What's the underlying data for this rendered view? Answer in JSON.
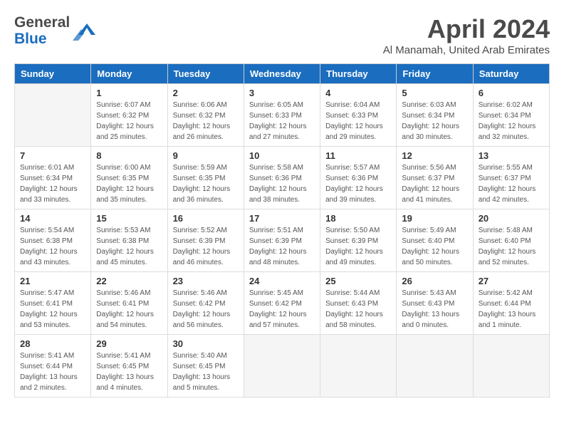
{
  "header": {
    "logo_line1": "General",
    "logo_line2": "Blue",
    "month_title": "April 2024",
    "subtitle": "Al Manamah, United Arab Emirates"
  },
  "days_of_week": [
    "Sunday",
    "Monday",
    "Tuesday",
    "Wednesday",
    "Thursday",
    "Friday",
    "Saturday"
  ],
  "weeks": [
    [
      null,
      {
        "day": "1",
        "sunrise": "6:07 AM",
        "sunset": "6:32 PM",
        "daylight": "12 hours and 25 minutes."
      },
      {
        "day": "2",
        "sunrise": "6:06 AM",
        "sunset": "6:32 PM",
        "daylight": "12 hours and 26 minutes."
      },
      {
        "day": "3",
        "sunrise": "6:05 AM",
        "sunset": "6:33 PM",
        "daylight": "12 hours and 27 minutes."
      },
      {
        "day": "4",
        "sunrise": "6:04 AM",
        "sunset": "6:33 PM",
        "daylight": "12 hours and 29 minutes."
      },
      {
        "day": "5",
        "sunrise": "6:03 AM",
        "sunset": "6:34 PM",
        "daylight": "12 hours and 30 minutes."
      },
      {
        "day": "6",
        "sunrise": "6:02 AM",
        "sunset": "6:34 PM",
        "daylight": "12 hours and 32 minutes."
      }
    ],
    [
      {
        "day": "7",
        "sunrise": "6:01 AM",
        "sunset": "6:34 PM",
        "daylight": "12 hours and 33 minutes."
      },
      {
        "day": "8",
        "sunrise": "6:00 AM",
        "sunset": "6:35 PM",
        "daylight": "12 hours and 35 minutes."
      },
      {
        "day": "9",
        "sunrise": "5:59 AM",
        "sunset": "6:35 PM",
        "daylight": "12 hours and 36 minutes."
      },
      {
        "day": "10",
        "sunrise": "5:58 AM",
        "sunset": "6:36 PM",
        "daylight": "12 hours and 38 minutes."
      },
      {
        "day": "11",
        "sunrise": "5:57 AM",
        "sunset": "6:36 PM",
        "daylight": "12 hours and 39 minutes."
      },
      {
        "day": "12",
        "sunrise": "5:56 AM",
        "sunset": "6:37 PM",
        "daylight": "12 hours and 41 minutes."
      },
      {
        "day": "13",
        "sunrise": "5:55 AM",
        "sunset": "6:37 PM",
        "daylight": "12 hours and 42 minutes."
      }
    ],
    [
      {
        "day": "14",
        "sunrise": "5:54 AM",
        "sunset": "6:38 PM",
        "daylight": "12 hours and 43 minutes."
      },
      {
        "day": "15",
        "sunrise": "5:53 AM",
        "sunset": "6:38 PM",
        "daylight": "12 hours and 45 minutes."
      },
      {
        "day": "16",
        "sunrise": "5:52 AM",
        "sunset": "6:39 PM",
        "daylight": "12 hours and 46 minutes."
      },
      {
        "day": "17",
        "sunrise": "5:51 AM",
        "sunset": "6:39 PM",
        "daylight": "12 hours and 48 minutes."
      },
      {
        "day": "18",
        "sunrise": "5:50 AM",
        "sunset": "6:39 PM",
        "daylight": "12 hours and 49 minutes."
      },
      {
        "day": "19",
        "sunrise": "5:49 AM",
        "sunset": "6:40 PM",
        "daylight": "12 hours and 50 minutes."
      },
      {
        "day": "20",
        "sunrise": "5:48 AM",
        "sunset": "6:40 PM",
        "daylight": "12 hours and 52 minutes."
      }
    ],
    [
      {
        "day": "21",
        "sunrise": "5:47 AM",
        "sunset": "6:41 PM",
        "daylight": "12 hours and 53 minutes."
      },
      {
        "day": "22",
        "sunrise": "5:46 AM",
        "sunset": "6:41 PM",
        "daylight": "12 hours and 54 minutes."
      },
      {
        "day": "23",
        "sunrise": "5:46 AM",
        "sunset": "6:42 PM",
        "daylight": "12 hours and 56 minutes."
      },
      {
        "day": "24",
        "sunrise": "5:45 AM",
        "sunset": "6:42 PM",
        "daylight": "12 hours and 57 minutes."
      },
      {
        "day": "25",
        "sunrise": "5:44 AM",
        "sunset": "6:43 PM",
        "daylight": "12 hours and 58 minutes."
      },
      {
        "day": "26",
        "sunrise": "5:43 AM",
        "sunset": "6:43 PM",
        "daylight": "13 hours and 0 minutes."
      },
      {
        "day": "27",
        "sunrise": "5:42 AM",
        "sunset": "6:44 PM",
        "daylight": "13 hours and 1 minute."
      }
    ],
    [
      {
        "day": "28",
        "sunrise": "5:41 AM",
        "sunset": "6:44 PM",
        "daylight": "13 hours and 2 minutes."
      },
      {
        "day": "29",
        "sunrise": "5:41 AM",
        "sunset": "6:45 PM",
        "daylight": "13 hours and 4 minutes."
      },
      {
        "day": "30",
        "sunrise": "5:40 AM",
        "sunset": "6:45 PM",
        "daylight": "13 hours and 5 minutes."
      },
      null,
      null,
      null,
      null
    ]
  ],
  "label_sunrise": "Sunrise:",
  "label_sunset": "Sunset:",
  "label_daylight": "Daylight:"
}
